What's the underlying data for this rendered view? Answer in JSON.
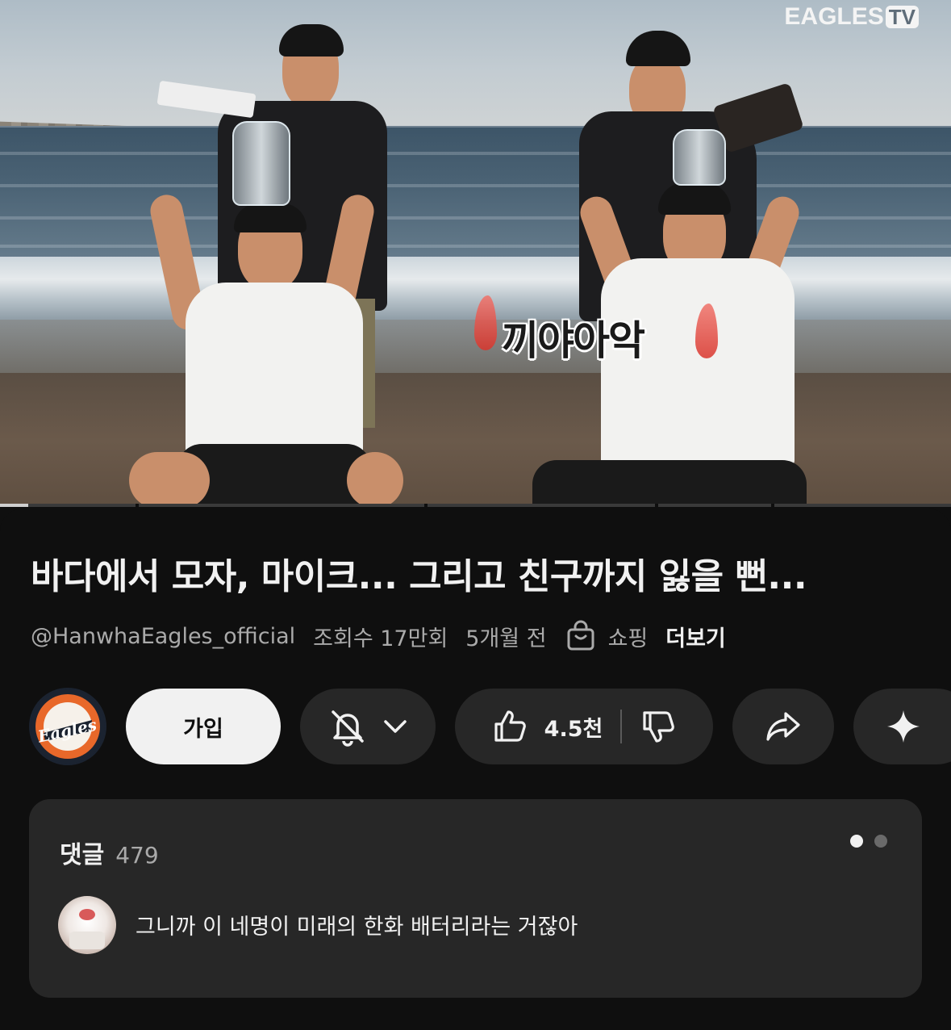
{
  "video": {
    "watermark": "EAGLES",
    "watermark_tv": "TV",
    "caption": "끼야아악",
    "progress_percent": 3
  },
  "title": "바다에서 모자, 마이크... 그리고 친구까지 잃을 뻔...",
  "meta": {
    "channel": "@HanwhaEagles_official",
    "views": "조회수 17만회",
    "age": "5개월 전",
    "shopping_label": "쇼핑",
    "more_label": "더보기"
  },
  "actions": {
    "avatar_lettering": "Eagles",
    "join_label": "가입",
    "like_count": "4.5천"
  },
  "comments": {
    "label": "댓글",
    "count": "479",
    "top_comment": "그니까 이 네명이 미래의 한화 배터리라는 거잖아"
  },
  "colors": {
    "background": "#0f0f0f",
    "pill": "#272727",
    "join_button": "#f1f1f1",
    "secondary_text": "#aaaaaa",
    "eagles_orange": "#e8682a"
  }
}
